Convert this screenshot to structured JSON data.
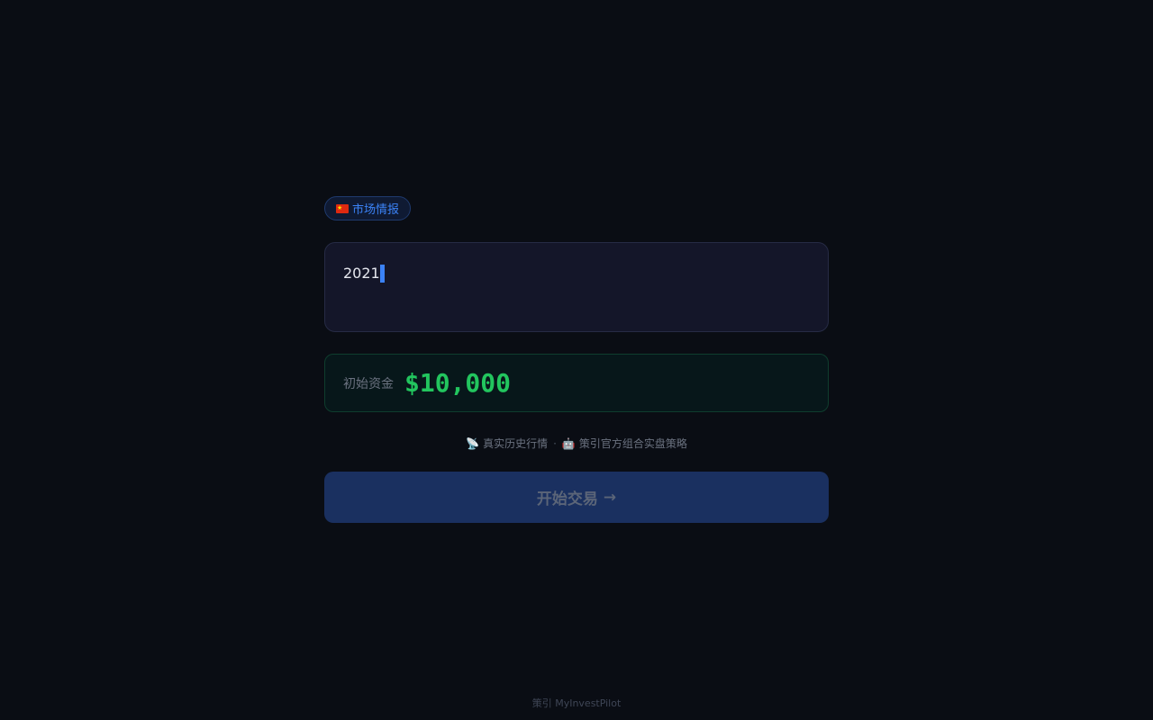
{
  "badge": {
    "flag_icon": "china-flag-icon",
    "label": "市场情报"
  },
  "year_input": {
    "value": "2021"
  },
  "capital": {
    "label": "初始资金",
    "value": "$10,000"
  },
  "info": {
    "item1_icon": "satellite-antenna-icon",
    "item1_text": "真实历史行情",
    "separator": "·",
    "item2_icon": "robot-icon",
    "item2_text": "策引官方组合实盘策略"
  },
  "start_button": {
    "label": "开始交易",
    "arrow": "→"
  },
  "footer": {
    "text": "策引 MyInvestPilot"
  },
  "colors": {
    "background": "#0a0d14",
    "accent": "#3b82f6",
    "capital_green": "#22c55e"
  }
}
